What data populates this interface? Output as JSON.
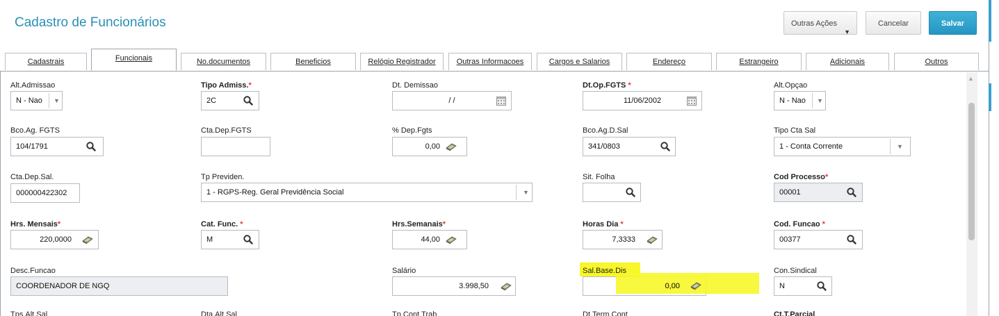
{
  "header": {
    "title": "Cadastro de Funcionários",
    "outras_label": "Outras Ações",
    "cancel_label": "Cancelar",
    "save_label": "Salvar"
  },
  "tabs": [
    {
      "label": "Cadastrais"
    },
    {
      "label": "Funcionais"
    },
    {
      "label": "No.documentos"
    },
    {
      "label": "Beneficios"
    },
    {
      "label": "Relógio Registrador"
    },
    {
      "label": "Outras Informacoes"
    },
    {
      "label": "Cargos e Salarios"
    },
    {
      "label": "Endereço"
    },
    {
      "label": "Estrangeiro"
    },
    {
      "label": "Adicionais"
    },
    {
      "label": "Outros"
    }
  ],
  "active_tab": "Funcionais",
  "form": {
    "alt_admissao": {
      "label": "Alt.Admissao",
      "value": "N - Nao"
    },
    "tipo_admiss": {
      "label": "Tipo Admiss.",
      "value": "2C"
    },
    "dt_demissao": {
      "label": "Dt. Demissao",
      "value": "/ /"
    },
    "dt_op_fgts": {
      "label": "Dt.Op.FGTS",
      "value": "11/06/2002"
    },
    "alt_opcao": {
      "label": "Alt.Opçao",
      "value": "N - Nao"
    },
    "bco_ag_fgts": {
      "label": "Bco.Ag. FGTS",
      "value": "104/1791"
    },
    "cta_dep_fgts": {
      "label": "Cta.Dep.FGTS",
      "value": ""
    },
    "pct_dep_fgts": {
      "label": "% Dep.Fgts",
      "value": "0,00"
    },
    "bco_ag_d_sal": {
      "label": "Bco.Ag.D.Sal",
      "value": "341/0803"
    },
    "tipo_cta_sal": {
      "label": "Tipo Cta Sal",
      "value": "1 - Conta Corrente"
    },
    "cta_dep_sal": {
      "label": "Cta.Dep.Sal.",
      "value": "000000422302"
    },
    "tp_previden": {
      "label": "Tp Previden.",
      "value": "1 - RGPS-Reg. Geral Previdência Social"
    },
    "sit_folha": {
      "label": "Sit. Folha",
      "value": ""
    },
    "cod_processo": {
      "label": "Cod Processo",
      "value": "00001"
    },
    "hrs_mensais": {
      "label": "Hrs. Mensais",
      "value": "220,0000"
    },
    "cat_func": {
      "label": "Cat. Func.",
      "value": "M"
    },
    "hrs_semanais": {
      "label": "Hrs.Semanais",
      "value": "44,00"
    },
    "horas_dia": {
      "label": "Horas Dia",
      "value": "7,3333"
    },
    "cod_funcao": {
      "label": "Cod. Funcao",
      "value": "00377"
    },
    "desc_funcao": {
      "label": "Desc.Funcao",
      "value": "COORDENADOR DE NGQ"
    },
    "salario": {
      "label": "Salário",
      "value": "3.998,50"
    },
    "sal_base_dis": {
      "label": "Sal.Base.Dis",
      "value": "0,00"
    },
    "con_sindical": {
      "label": "Con.Sindical",
      "value": "N"
    }
  },
  "partial_row_labels": [
    "Tps.Alt.Sal",
    "Dta.Alt.Sal",
    "Tp.Cont.Trab",
    "Dt.Term.Cont",
    "Ct.T.Parcial"
  ],
  "required_mark": "*",
  "highlight_color": "#f7f72a",
  "accent_color": "#2a8fb5",
  "icons": {
    "lookup": "search-icon",
    "calendar": "calendar-icon",
    "calculator": "calculator-icon",
    "dropdown": "chevron-down-icon"
  }
}
